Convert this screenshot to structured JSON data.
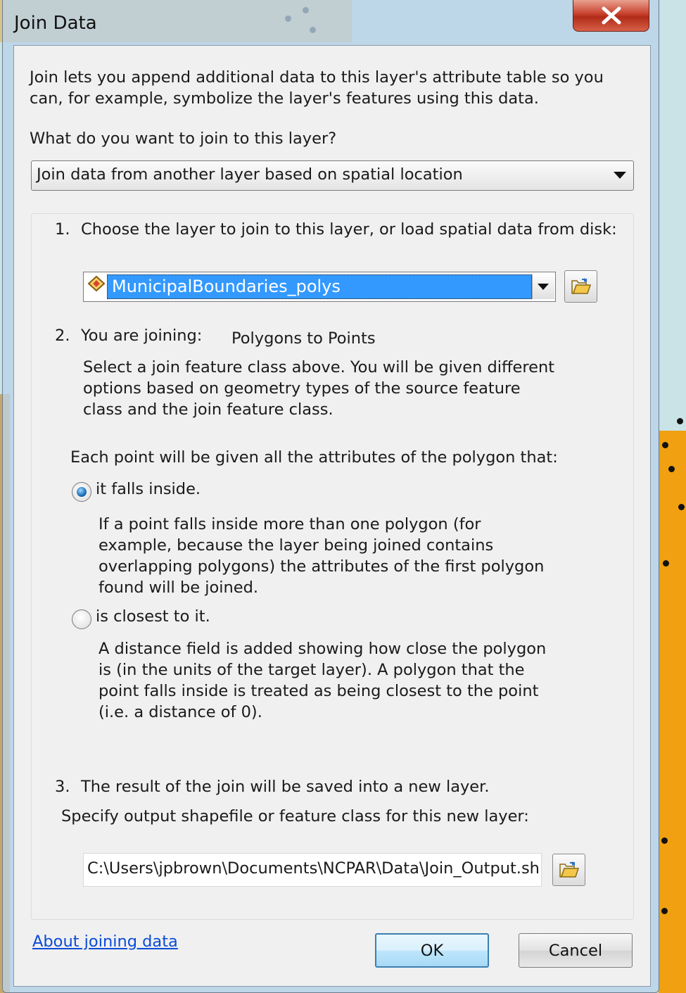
{
  "window": {
    "title": "Join Data",
    "close_glyph": "X"
  },
  "intro": {
    "text": "Join lets you append additional data to this layer's attribute table so you can, for example, symbolize the layer's features using this data.",
    "question": "What do you want to join to this layer?"
  },
  "join_type": {
    "selected": "Join data from another layer based on spatial location"
  },
  "step1": {
    "number": "1.",
    "label": "Choose the layer to join to this layer, or load spatial data from disk:",
    "layer_selected": "MunicipalBoundaries_polys"
  },
  "step2": {
    "number": "2.",
    "label": "You are joining:",
    "join_kind": "Polygons to Points",
    "description": "Select a join feature class above.  You will be given different options based on geometry types of the source feature class and the join feature class.",
    "options_intro": "Each point will be given all the attributes of the polygon that:",
    "option_inside": {
      "label": "it falls inside.",
      "checked": true,
      "description": "If a point falls inside more than one polygon (for example, because the layer being joined contains overlapping polygons) the attributes of the first polygon found will be joined."
    },
    "option_closest": {
      "label": "is closest to it.",
      "checked": false,
      "description": "A distance field is added showing how close the polygon is (in the units of the target layer). A polygon that the point falls inside is treated as being closest to the point (i.e. a distance of 0)."
    }
  },
  "step3": {
    "number": "3.",
    "label": "The result of the join will be saved into a new layer.",
    "output_label": "Specify output shapefile or feature class for this new layer:",
    "output_path": "C:\\Users\\jpbrown\\Documents\\NCPAR\\Data\\Join_Output.shp"
  },
  "footer": {
    "help_link": "About joining data",
    "ok": "OK",
    "cancel": "Cancel"
  },
  "colors": {
    "selection": "#3399ff",
    "link": "#0b4bd6",
    "close_button": "#c8402c"
  }
}
